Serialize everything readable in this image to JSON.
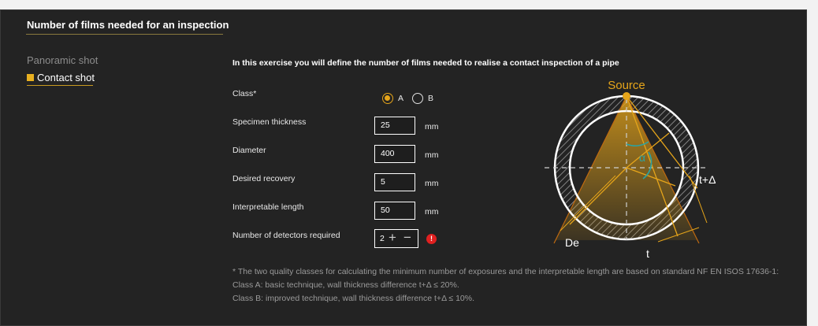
{
  "header": {
    "title": "Number of films needed for an inspection"
  },
  "sidebar": {
    "items": [
      {
        "label": "Panoramic shot",
        "active": false
      },
      {
        "label": "Contact shot",
        "active": true
      }
    ]
  },
  "main": {
    "intro": "In this exercise you will define the number of films needed to realise a contact inspection of a pipe",
    "class_label": "Class*",
    "class_options": [
      {
        "label": "A",
        "selected": true
      },
      {
        "label": "B",
        "selected": false
      }
    ],
    "fields": {
      "thickness": {
        "label": "Specimen thickness",
        "value": "25",
        "unit": "mm"
      },
      "diameter": {
        "label": "Diameter",
        "value": "400",
        "unit": "mm"
      },
      "recovery": {
        "label": "Desired recovery",
        "value": "5",
        "unit": "mm"
      },
      "length": {
        "label": "Interpretable length",
        "value": "50",
        "unit": "mm"
      }
    },
    "detectors": {
      "label": "Number of detectors required",
      "value": "2",
      "alert": "!"
    },
    "notes": [
      "* The two quality classes for calculating the minimum number of exposures and the interpretable length are based on standard NF EN ISOS 17636-1:",
      "Class A: basic technique, wall thickness difference t+Δ ≤ 20%.",
      "Class B: improved technique, wall thickness difference t+Δ ≤ 10%."
    ]
  },
  "diagram": {
    "source_label": "Source",
    "alpha_label": "α",
    "t_delta_label": "t+Δ",
    "de_label": "De",
    "t_label": "t",
    "colors": {
      "accent": "#e6a51a",
      "alpha": "#2aa3a3"
    }
  }
}
